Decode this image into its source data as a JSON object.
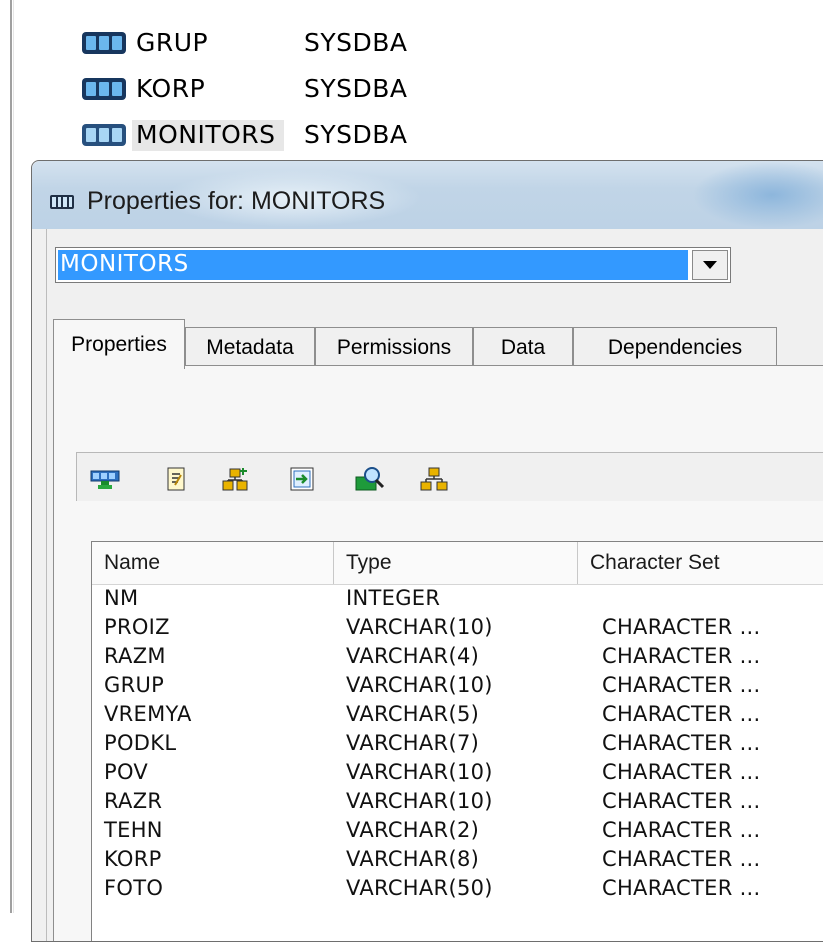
{
  "background_list": [
    {
      "name": "GRUP",
      "owner": "SYSDBA"
    },
    {
      "name": "KORP",
      "owner": "SYSDBA"
    },
    {
      "name": "MONITORS",
      "owner": "SYSDBA"
    }
  ],
  "window": {
    "title": "Properties for: MONITORS",
    "combo_value": "MONITORS"
  },
  "tabs": [
    "Properties",
    "Metadata",
    "Permissions",
    "Data",
    "Dependencies"
  ],
  "toolbar_icons": [
    "show-form-icon",
    "edit-icon",
    "add-field-icon",
    "import-icon",
    "search-icon",
    "tree-icon"
  ],
  "columns": [
    "Name",
    "Type",
    "Character Set"
  ],
  "rows": [
    {
      "name": "NM",
      "type": "INTEGER",
      "charset": ""
    },
    {
      "name": "PROIZ",
      "type": "VARCHAR(10)",
      "charset": "CHARACTER ..."
    },
    {
      "name": "RAZM",
      "type": "VARCHAR(4)",
      "charset": "CHARACTER ..."
    },
    {
      "name": "GRUP",
      "type": "VARCHAR(10)",
      "charset": "CHARACTER ..."
    },
    {
      "name": "VREMYA",
      "type": "VARCHAR(5)",
      "charset": "CHARACTER ..."
    },
    {
      "name": "PODKL",
      "type": "VARCHAR(7)",
      "charset": "CHARACTER ..."
    },
    {
      "name": "POV",
      "type": "VARCHAR(10)",
      "charset": "CHARACTER ..."
    },
    {
      "name": "RAZR",
      "type": "VARCHAR(10)",
      "charset": "CHARACTER ..."
    },
    {
      "name": "TEHN",
      "type": "VARCHAR(2)",
      "charset": "CHARACTER ..."
    },
    {
      "name": "KORP",
      "type": "VARCHAR(8)",
      "charset": "CHARACTER ..."
    },
    {
      "name": "FOTO",
      "type": "VARCHAR(50)",
      "charset": "CHARACTER ..."
    }
  ],
  "colors": {
    "selection": "#3399ff",
    "titlebar": "#c1d5e7"
  }
}
